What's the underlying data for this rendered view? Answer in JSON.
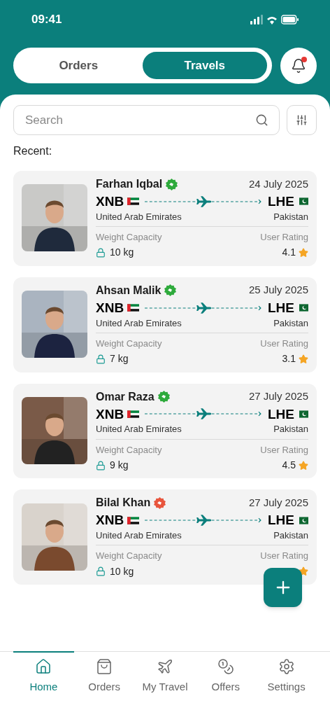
{
  "status_bar": {
    "time": "09:41"
  },
  "tabs": [
    {
      "label": "Orders",
      "selected": false
    },
    {
      "label": "Travels",
      "selected": true
    }
  ],
  "notifications": {
    "unread": true
  },
  "search": {
    "placeholder": "Search"
  },
  "section_title": "Recent:",
  "travelers": [
    {
      "name": "Farhan Iqbal",
      "color": "#2eaa3c",
      "date": "24 July 2025",
      "from_code": "XNB",
      "from_country": "United Arab Emirates",
      "to_code": "LHE",
      "to_country": "Pakistan",
      "weight_label": "Weight Capacity",
      "weight": "10 kg",
      "rating_label": "User Rating",
      "rating": "4.1"
    },
    {
      "name": "Ahsan Malik",
      "color": "#2eaa3c",
      "date": "25 July 2025",
      "from_code": "XNB",
      "from_country": "United Arab Emirates",
      "to_code": "LHE",
      "to_country": "Pakistan",
      "weight_label": "Weight Capacity",
      "weight": "7 kg",
      "rating_label": "User Rating",
      "rating": "3.1"
    },
    {
      "name": "Omar Raza",
      "color": "#2eaa3c",
      "date": "27 July 2025",
      "from_code": "XNB",
      "from_country": "United Arab Emirates",
      "to_code": "LHE",
      "to_country": "Pakistan",
      "weight_label": "Weight Capacity",
      "weight": "9 kg",
      "rating_label": "User Rating",
      "rating": "4.5"
    },
    {
      "name": "Bilal Khan",
      "color": "#e8553d",
      "date": "27 July 2025",
      "from_code": "XNB",
      "from_country": "United Arab Emirates",
      "to_code": "LHE",
      "to_country": "Pakistan",
      "weight_label": "Weight Capacity",
      "weight": "10 kg",
      "rating_label": "User Rating"
    }
  ],
  "nav": [
    {
      "label": "Home",
      "selected": true
    },
    {
      "label": "Orders",
      "selected": false
    },
    {
      "label": "My Travel",
      "selected": false
    },
    {
      "label": "Offers",
      "selected": false
    },
    {
      "label": "Settings",
      "selected": false
    }
  ]
}
